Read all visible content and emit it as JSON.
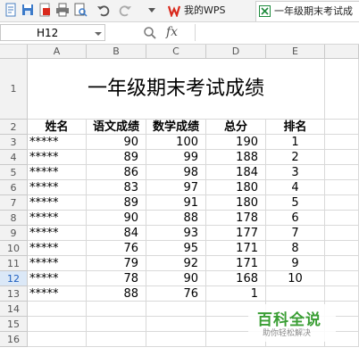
{
  "tabs": [
    {
      "label": "我的WPS",
      "active": false
    },
    {
      "label": "一年级期末考试成",
      "active": true
    }
  ],
  "formula": {
    "cell_ref": "H12",
    "fx": "fx",
    "value": ""
  },
  "columns": [
    "A",
    "B",
    "C",
    "D",
    "E"
  ],
  "rows": [
    "1",
    "2",
    "3",
    "4",
    "5",
    "6",
    "7",
    "8",
    "9",
    "10",
    "11",
    "12",
    "13",
    "14",
    "15",
    "16"
  ],
  "selected_row": "12",
  "sheet": {
    "title": "一年级期末考试成绩",
    "headers": [
      "姓名",
      "语文成绩",
      "数学成绩",
      "总分",
      "排名"
    ],
    "records": [
      [
        "*****",
        "90",
        "100",
        "190",
        "1"
      ],
      [
        "*****",
        "89",
        "99",
        "188",
        "2"
      ],
      [
        "*****",
        "86",
        "98",
        "184",
        "3"
      ],
      [
        "*****",
        "83",
        "97",
        "180",
        "4"
      ],
      [
        "*****",
        "89",
        "91",
        "180",
        "5"
      ],
      [
        "*****",
        "90",
        "88",
        "178",
        "6"
      ],
      [
        "*****",
        "84",
        "93",
        "177",
        "7"
      ],
      [
        "*****",
        "76",
        "95",
        "171",
        "8"
      ],
      [
        "*****",
        "79",
        "92",
        "171",
        "9"
      ],
      [
        "*****",
        "78",
        "90",
        "168",
        "10"
      ],
      [
        "*****",
        "88",
        "76",
        "1",
        ""
      ]
    ]
  },
  "watermark": {
    "main": "百科全说",
    "sub": "助你轻松解决"
  },
  "colors": {
    "wps_red": "#d9291c",
    "grid": "#d9d9d9",
    "selected_row": "#dbe8f7"
  }
}
